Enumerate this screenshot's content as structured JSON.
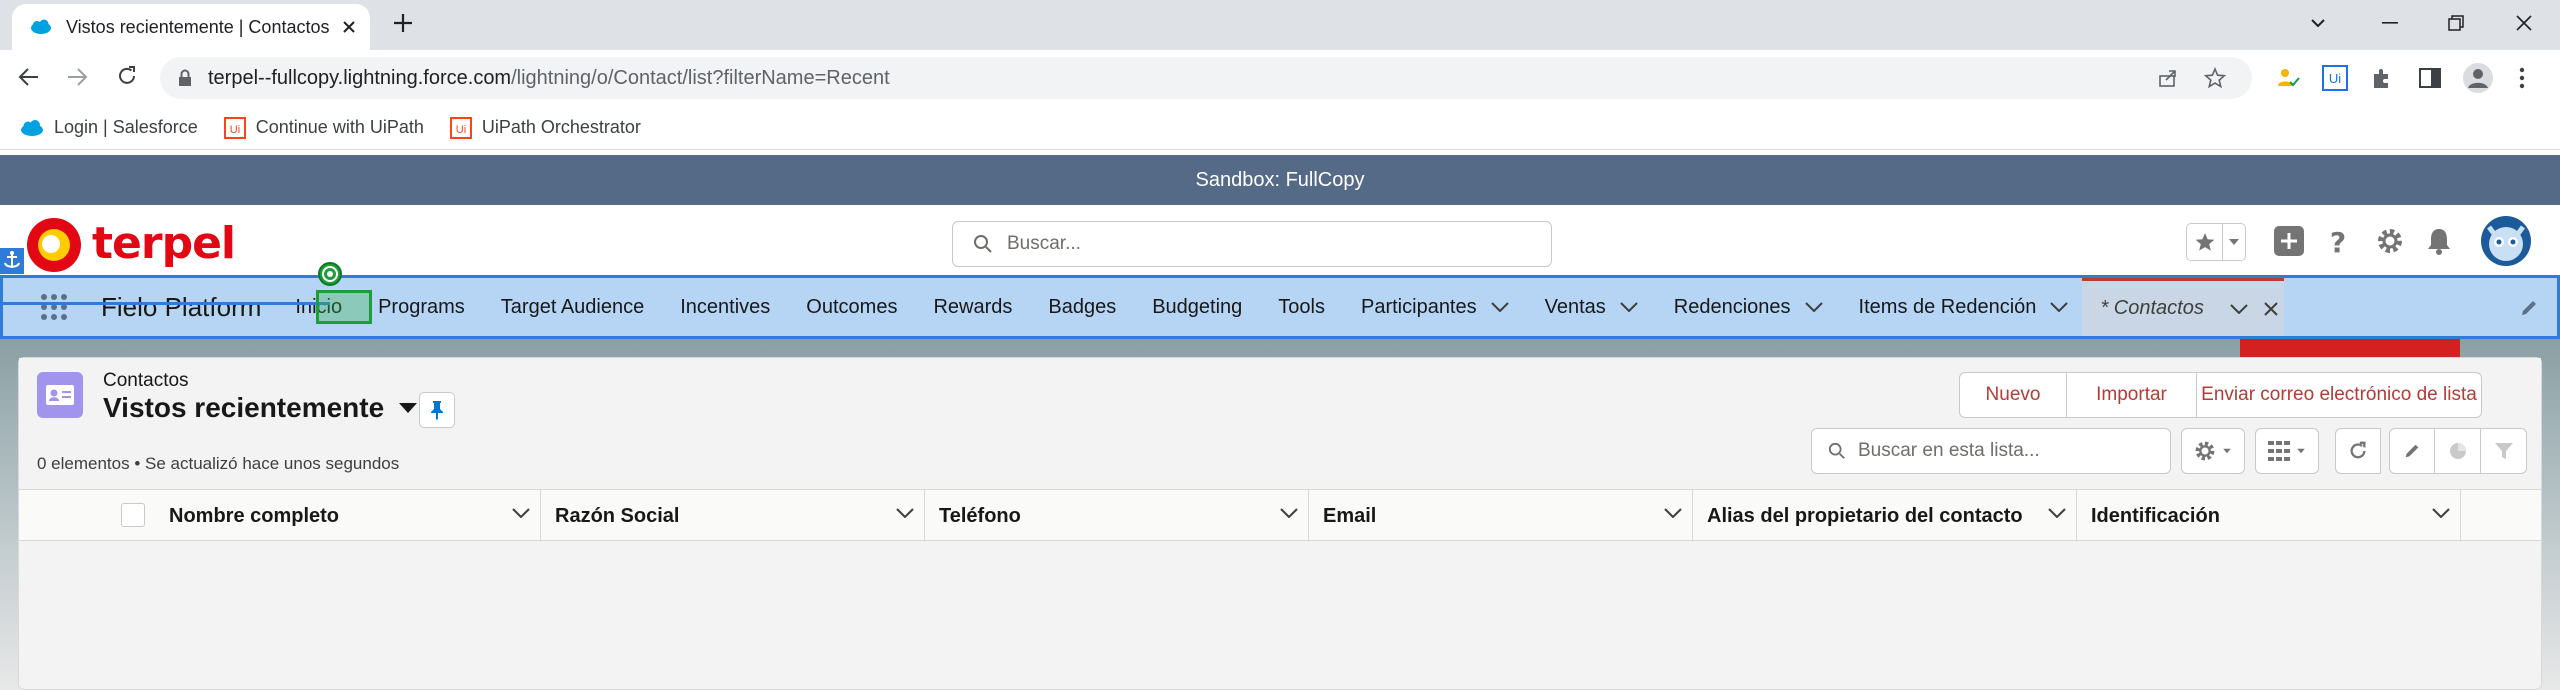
{
  "browser": {
    "tab_title": "Vistos recientemente | Contactos",
    "url_host": "terpel--fullcopy.lightning.force.com",
    "url_path": "/lightning/o/Contact/list?filterName=Recent",
    "bookmarks": [
      {
        "label": "Login | Salesforce",
        "icon": "salesforce-cloud-icon"
      },
      {
        "label": "Continue with UiPath",
        "icon": "uipath-icon"
      },
      {
        "label": "UiPath Orchestrator",
        "icon": "uipath-icon"
      }
    ]
  },
  "sandbox_banner": "Sandbox: FullCopy",
  "header": {
    "logo_text": "terpel",
    "search_placeholder": "Buscar..."
  },
  "nav": {
    "app_name": "Fielo Platform",
    "items": [
      {
        "label": "Inicio",
        "dropdown": false
      },
      {
        "label": "Programs",
        "dropdown": false
      },
      {
        "label": "Target Audience",
        "dropdown": false
      },
      {
        "label": "Incentives",
        "dropdown": false
      },
      {
        "label": "Outcomes",
        "dropdown": false
      },
      {
        "label": "Rewards",
        "dropdown": false
      },
      {
        "label": "Badges",
        "dropdown": false
      },
      {
        "label": "Budgeting",
        "dropdown": false
      },
      {
        "label": "Tools",
        "dropdown": false
      },
      {
        "label": "Participantes",
        "dropdown": true
      },
      {
        "label": "Ventas",
        "dropdown": true
      },
      {
        "label": "Redenciones",
        "dropdown": true
      },
      {
        "label": "Items de Redención",
        "dropdown": true
      }
    ],
    "active_tab": "* Contactos"
  },
  "list": {
    "object_label": "Contactos",
    "view_name": "Vistos recientemente",
    "status": "0 elementos • Se actualizó hace unos segundos",
    "search_placeholder": "Buscar en esta lista...",
    "buttons": {
      "new": "Nuevo",
      "import": "Importar",
      "email": "Enviar correo electrónico de lista"
    },
    "columns": [
      "Nombre completo",
      "Razón Social",
      "Teléfono",
      "Email",
      "Alias del propietario del contacto",
      "Identificación"
    ]
  },
  "colors": {
    "sandbox_bar": "#546a87",
    "nav_highlight": "#b6d5f5",
    "brand_red": "#e30613",
    "button_text": "#b23c36",
    "contacts_icon": "#a094ed"
  }
}
